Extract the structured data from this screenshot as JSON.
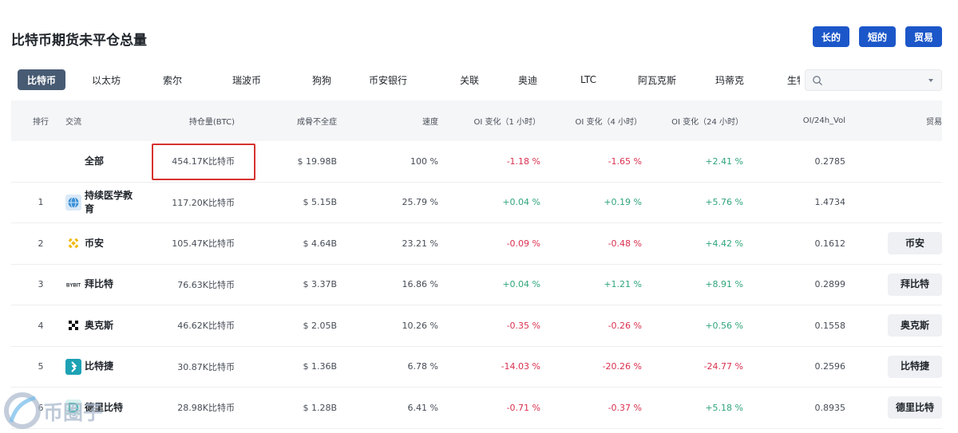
{
  "page": {
    "title": "比特币期货未平仓总量"
  },
  "actions": [
    {
      "label": "长的"
    },
    {
      "label": "短的"
    },
    {
      "label": "贸易"
    }
  ],
  "tabs": [
    {
      "label": "比特币",
      "active": true
    },
    {
      "label": "以太坊"
    },
    {
      "label": "索尔"
    },
    {
      "label": "瑞波币"
    },
    {
      "label": "狗狗"
    },
    {
      "label": "币安银行"
    },
    {
      "label": "关联"
    },
    {
      "label": "奥迪"
    },
    {
      "label": "LTC"
    },
    {
      "label": "阿瓦克斯"
    },
    {
      "label": "玛蒂克"
    },
    {
      "label": "生物多"
    }
  ],
  "search": {
    "icon": "search-icon",
    "value": ""
  },
  "table": {
    "headers": {
      "rank": "排行",
      "exchange": "交流",
      "oi": "持仓量(BTC)",
      "volume": "成骨不全症",
      "rate": "速度",
      "change_1h": "OI 变化（1 小时）",
      "change_4h": "OI 变化（4 小时）",
      "change_24h": "OI 变化（24 小时）",
      "ratio": "OI/24h_Vol",
      "trade": "贸易"
    },
    "rows": [
      {
        "rank": "",
        "exchange": "全部",
        "oi": "454.17K比特币",
        "volume": "$ 19.98B",
        "rate": "100 %",
        "change_1h": "-1.18 %",
        "change_4h": "-1.65 %",
        "change_24h": "+2.41 %",
        "ratio": "0.2785",
        "trade": ""
      },
      {
        "rank": "1",
        "exchange": "持续医学教育",
        "logo": "globe-icon",
        "oi": "117.20K比特币",
        "volume": "$ 5.15B",
        "rate": "25.79 %",
        "change_1h": "+0.04 %",
        "change_4h": "+0.19 %",
        "change_24h": "+5.76 %",
        "ratio": "1.4734",
        "trade": ""
      },
      {
        "rank": "2",
        "exchange": "币安",
        "logo": "binance-logo-icon",
        "oi": "105.47K比特币",
        "volume": "$ 4.64B",
        "rate": "23.21 %",
        "change_1h": "-0.09 %",
        "change_4h": "-0.48 %",
        "change_24h": "+4.42 %",
        "ratio": "0.1612",
        "trade": "币安"
      },
      {
        "rank": "3",
        "exchange": "拜比特",
        "logo": "bybit-logo-icon",
        "logo_text": "BYBIT",
        "oi": "76.63K比特币",
        "volume": "$ 3.37B",
        "rate": "16.86 %",
        "change_1h": "+0.04 %",
        "change_4h": "+1.21 %",
        "change_24h": "+8.91 %",
        "ratio": "0.2899",
        "trade": "拜比特"
      },
      {
        "rank": "4",
        "exchange": "奥克斯",
        "logo": "okx-logo-icon",
        "oi": "46.62K比特币",
        "volume": "$ 2.05B",
        "rate": "10.26 %",
        "change_1h": "-0.35 %",
        "change_4h": "-0.26 %",
        "change_24h": "+0.56 %",
        "ratio": "0.1558",
        "trade": "奥克斯"
      },
      {
        "rank": "5",
        "exchange": "比特捷",
        "logo": "bitget-logo-icon",
        "oi": "30.87K比特币",
        "volume": "$ 1.36B",
        "rate": "6.78 %",
        "change_1h": "-14.03 %",
        "change_4h": "-20.26 %",
        "change_24h": "-24.77 %",
        "ratio": "0.2596",
        "trade": "比特捷"
      },
      {
        "rank": "6",
        "exchange": "德里比特",
        "logo": "deribit-logo-icon",
        "oi": "28.98K比特币",
        "volume": "$ 1.28B",
        "rate": "6.41 %",
        "change_1h": "-0.71 %",
        "change_4h": "-0.37 %",
        "change_24h": "+5.18 %",
        "ratio": "0.8935",
        "trade": "德里比特"
      }
    ]
  },
  "watermark": {
    "text": "币圈子"
  },
  "colors": {
    "accent": "#1c57c9",
    "positive": "#2ea57a",
    "negative": "#d9304f",
    "highlight": "#d6322d",
    "active_tab": "#475b73"
  }
}
